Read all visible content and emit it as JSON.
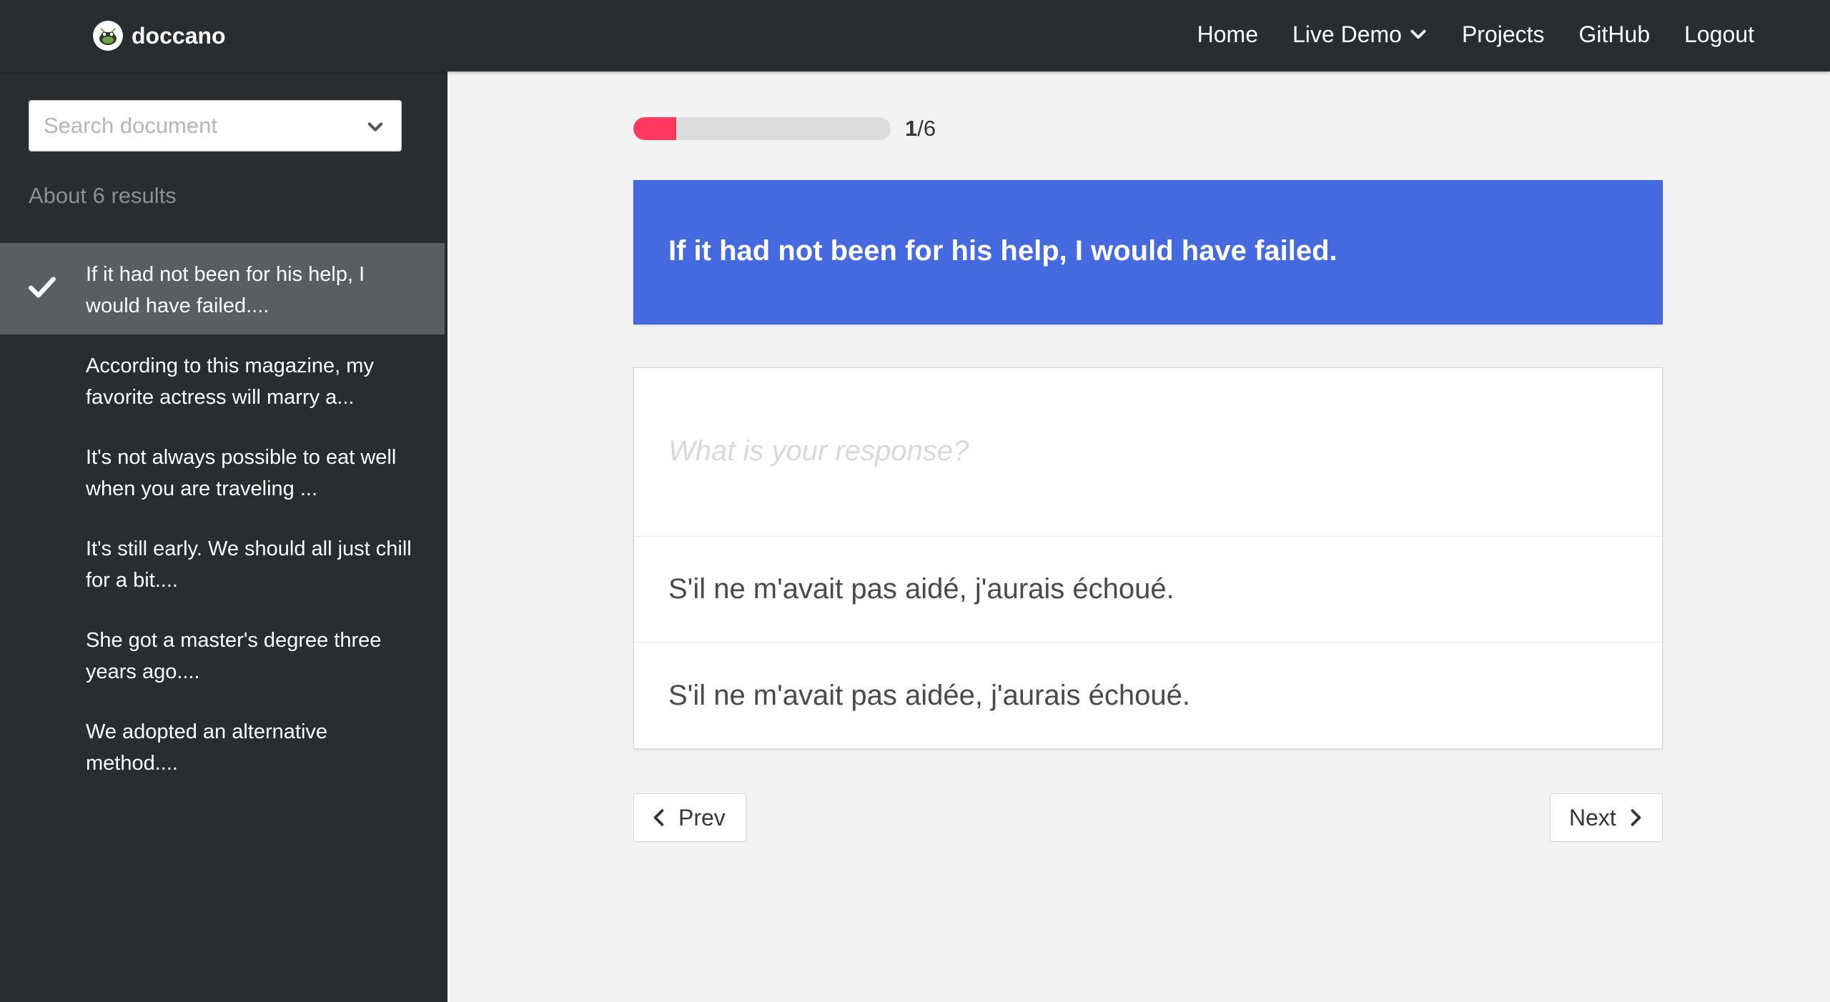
{
  "app": {
    "brand": "doccano"
  },
  "nav": {
    "home": "Home",
    "live_demo": "Live Demo",
    "projects": "Projects",
    "github": "GitHub",
    "logout": "Logout"
  },
  "sidebar": {
    "search_placeholder": "Search document",
    "results_text": "About 6 results",
    "items": [
      {
        "label": "If it had not been for his help, I would have failed....",
        "done": true
      },
      {
        "label": "According to this magazine, my favorite actress will marry a...",
        "done": false
      },
      {
        "label": "It's not always possible to eat well when you are traveling ...",
        "done": false
      },
      {
        "label": "It's still early. We should all just chill for a bit....",
        "done": false
      },
      {
        "label": "She got a master's degree three years ago....",
        "done": false
      },
      {
        "label": "We adopted an alternative method....",
        "done": false
      }
    ]
  },
  "main": {
    "progress": {
      "current": "1",
      "total": "/6",
      "fraction": 0.167
    },
    "source_text": "If it had not been for his help, I would have failed.",
    "response_placeholder": "What is your response?",
    "answers": [
      "S'il ne m'avait pas aidé, j'aurais échoué.",
      "S'il ne m'avait pas aidée, j'aurais échoué."
    ],
    "prev_label": "Prev",
    "next_label": "Next"
  },
  "colors": {
    "navbar": "#2a2d30",
    "accent_blue": "#4569de",
    "progress_fill": "#ff3860"
  },
  "icons": {
    "logo": "doccano-logo-icon",
    "dropdown": "chevron-down-icon",
    "check": "check-icon",
    "prev": "chevron-left-icon",
    "next": "chevron-right-icon"
  }
}
